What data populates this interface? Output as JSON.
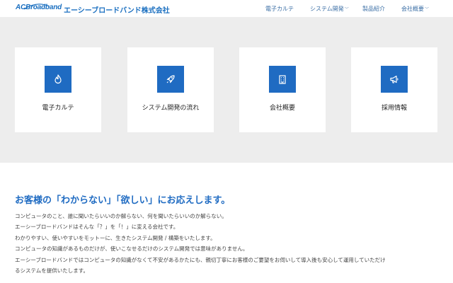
{
  "header": {
    "logo_text": "ACBroadband",
    "brand_name": "エーシーブロードバンド株式会社",
    "nav": [
      {
        "label": "電子カルテ",
        "has_dropdown": false
      },
      {
        "label": "システム開発",
        "has_dropdown": true
      },
      {
        "label": "製品紹介",
        "has_dropdown": false
      },
      {
        "label": "会社概要",
        "has_dropdown": true
      }
    ]
  },
  "cards": [
    {
      "label": "電子カルテ",
      "icon": "flame-icon"
    },
    {
      "label": "システム開発の流れ",
      "icon": "rocket-icon"
    },
    {
      "label": "会社概要",
      "icon": "building-icon"
    },
    {
      "label": "採用情報",
      "icon": "megaphone-icon"
    }
  ],
  "intro": {
    "title": "お客様の「わからない」「欲しい」にお応えします。",
    "lines": [
      "コンピュータのこと、誰に聞いたらいいのか解らない、何を聞いたらいいのか解らない。",
      "エーシーブロードバンドはそんな「？」を「！」に変える会社です。",
      "わかりやすい、使いやすいをモットーに、生きたシステム開発 / 構築をいたします。",
      "コンピュータの知識があるものだけが、使いこなせるだけのシステム開発では意味がありません。",
      "エーシーブロードバンドではコンピュータの知識がなくて不安があるかたにも、親切丁寧にお客様のご要望をお伺いして導入後も安心して運用していただけ",
      "るシステムを提供いたします。"
    ]
  },
  "colors": {
    "accent": "#1f6bc2",
    "band_bg": "#ededed",
    "nav_text": "#3a6ea5"
  }
}
